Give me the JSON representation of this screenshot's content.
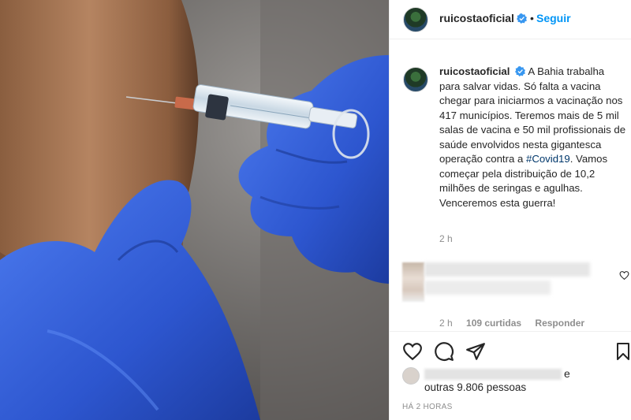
{
  "post": {
    "username": "ruicostaoficial",
    "verified": true,
    "follow_separator": "•",
    "follow_label": "Seguir"
  },
  "caption": {
    "username": "ruicostaoficial",
    "text_before": "A Bahia trabalha para salvar vidas. Só falta a vacina chegar para iniciarmos a vacinação nos 417 municípios. Teremos mais de 5 mil salas de vacina e 50 mil profissionais de saúde envolvidos nesta gigantesca operação contra a ",
    "hashtag": "#Covid19",
    "text_after": ". Vamos começar pela distribuição de 10,2 milhões de seringas e agulhas. Venceremos esta guerra!",
    "timestamp": "2 h"
  },
  "comment": {
    "timestamp": "2 h",
    "likes": "109 curtidas",
    "reply_label": "Responder"
  },
  "actions": {
    "like_icon": "heart-icon",
    "comment_icon": "comment-icon",
    "share_icon": "share-icon",
    "save_icon": "bookmark-icon"
  },
  "likes": {
    "suffix": "e",
    "others": "outras 9.806 pessoas"
  },
  "posted_time": "HÁ 2 HORAS",
  "colors": {
    "link_blue": "#0095f6",
    "hashtag": "#00376b",
    "glove_blue": "#2e5bd8",
    "muted": "#8e8e8e"
  }
}
